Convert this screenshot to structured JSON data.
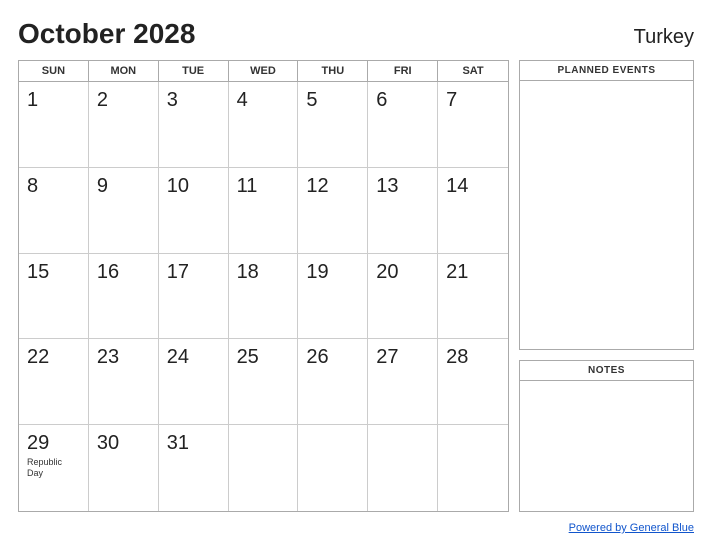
{
  "header": {
    "title": "October 2028",
    "country": "Turkey"
  },
  "calendar": {
    "day_headers": [
      "SUN",
      "MON",
      "TUE",
      "WED",
      "THU",
      "FRI",
      "SAT"
    ],
    "days": [
      {
        "day": 1,
        "event": ""
      },
      {
        "day": 2,
        "event": ""
      },
      {
        "day": 3,
        "event": ""
      },
      {
        "day": 4,
        "event": ""
      },
      {
        "day": 5,
        "event": ""
      },
      {
        "day": 6,
        "event": ""
      },
      {
        "day": 7,
        "event": ""
      },
      {
        "day": 8,
        "event": ""
      },
      {
        "day": 9,
        "event": ""
      },
      {
        "day": 10,
        "event": ""
      },
      {
        "day": 11,
        "event": ""
      },
      {
        "day": 12,
        "event": ""
      },
      {
        "day": 13,
        "event": ""
      },
      {
        "day": 14,
        "event": ""
      },
      {
        "day": 15,
        "event": ""
      },
      {
        "day": 16,
        "event": ""
      },
      {
        "day": 17,
        "event": ""
      },
      {
        "day": 18,
        "event": ""
      },
      {
        "day": 19,
        "event": ""
      },
      {
        "day": 20,
        "event": ""
      },
      {
        "day": 21,
        "event": ""
      },
      {
        "day": 22,
        "event": ""
      },
      {
        "day": 23,
        "event": ""
      },
      {
        "day": 24,
        "event": ""
      },
      {
        "day": 25,
        "event": ""
      },
      {
        "day": 26,
        "event": ""
      },
      {
        "day": 27,
        "event": ""
      },
      {
        "day": 28,
        "event": ""
      },
      {
        "day": 29,
        "event": "Republic Day"
      },
      {
        "day": 30,
        "event": ""
      },
      {
        "day": 31,
        "event": ""
      }
    ],
    "start_day_of_week": 0,
    "empty_cells_start": 0
  },
  "sidebar": {
    "planned_events_label": "PLANNED EVENTS",
    "notes_label": "NOTES"
  },
  "footer": {
    "link_text": "Powered by General Blue"
  }
}
